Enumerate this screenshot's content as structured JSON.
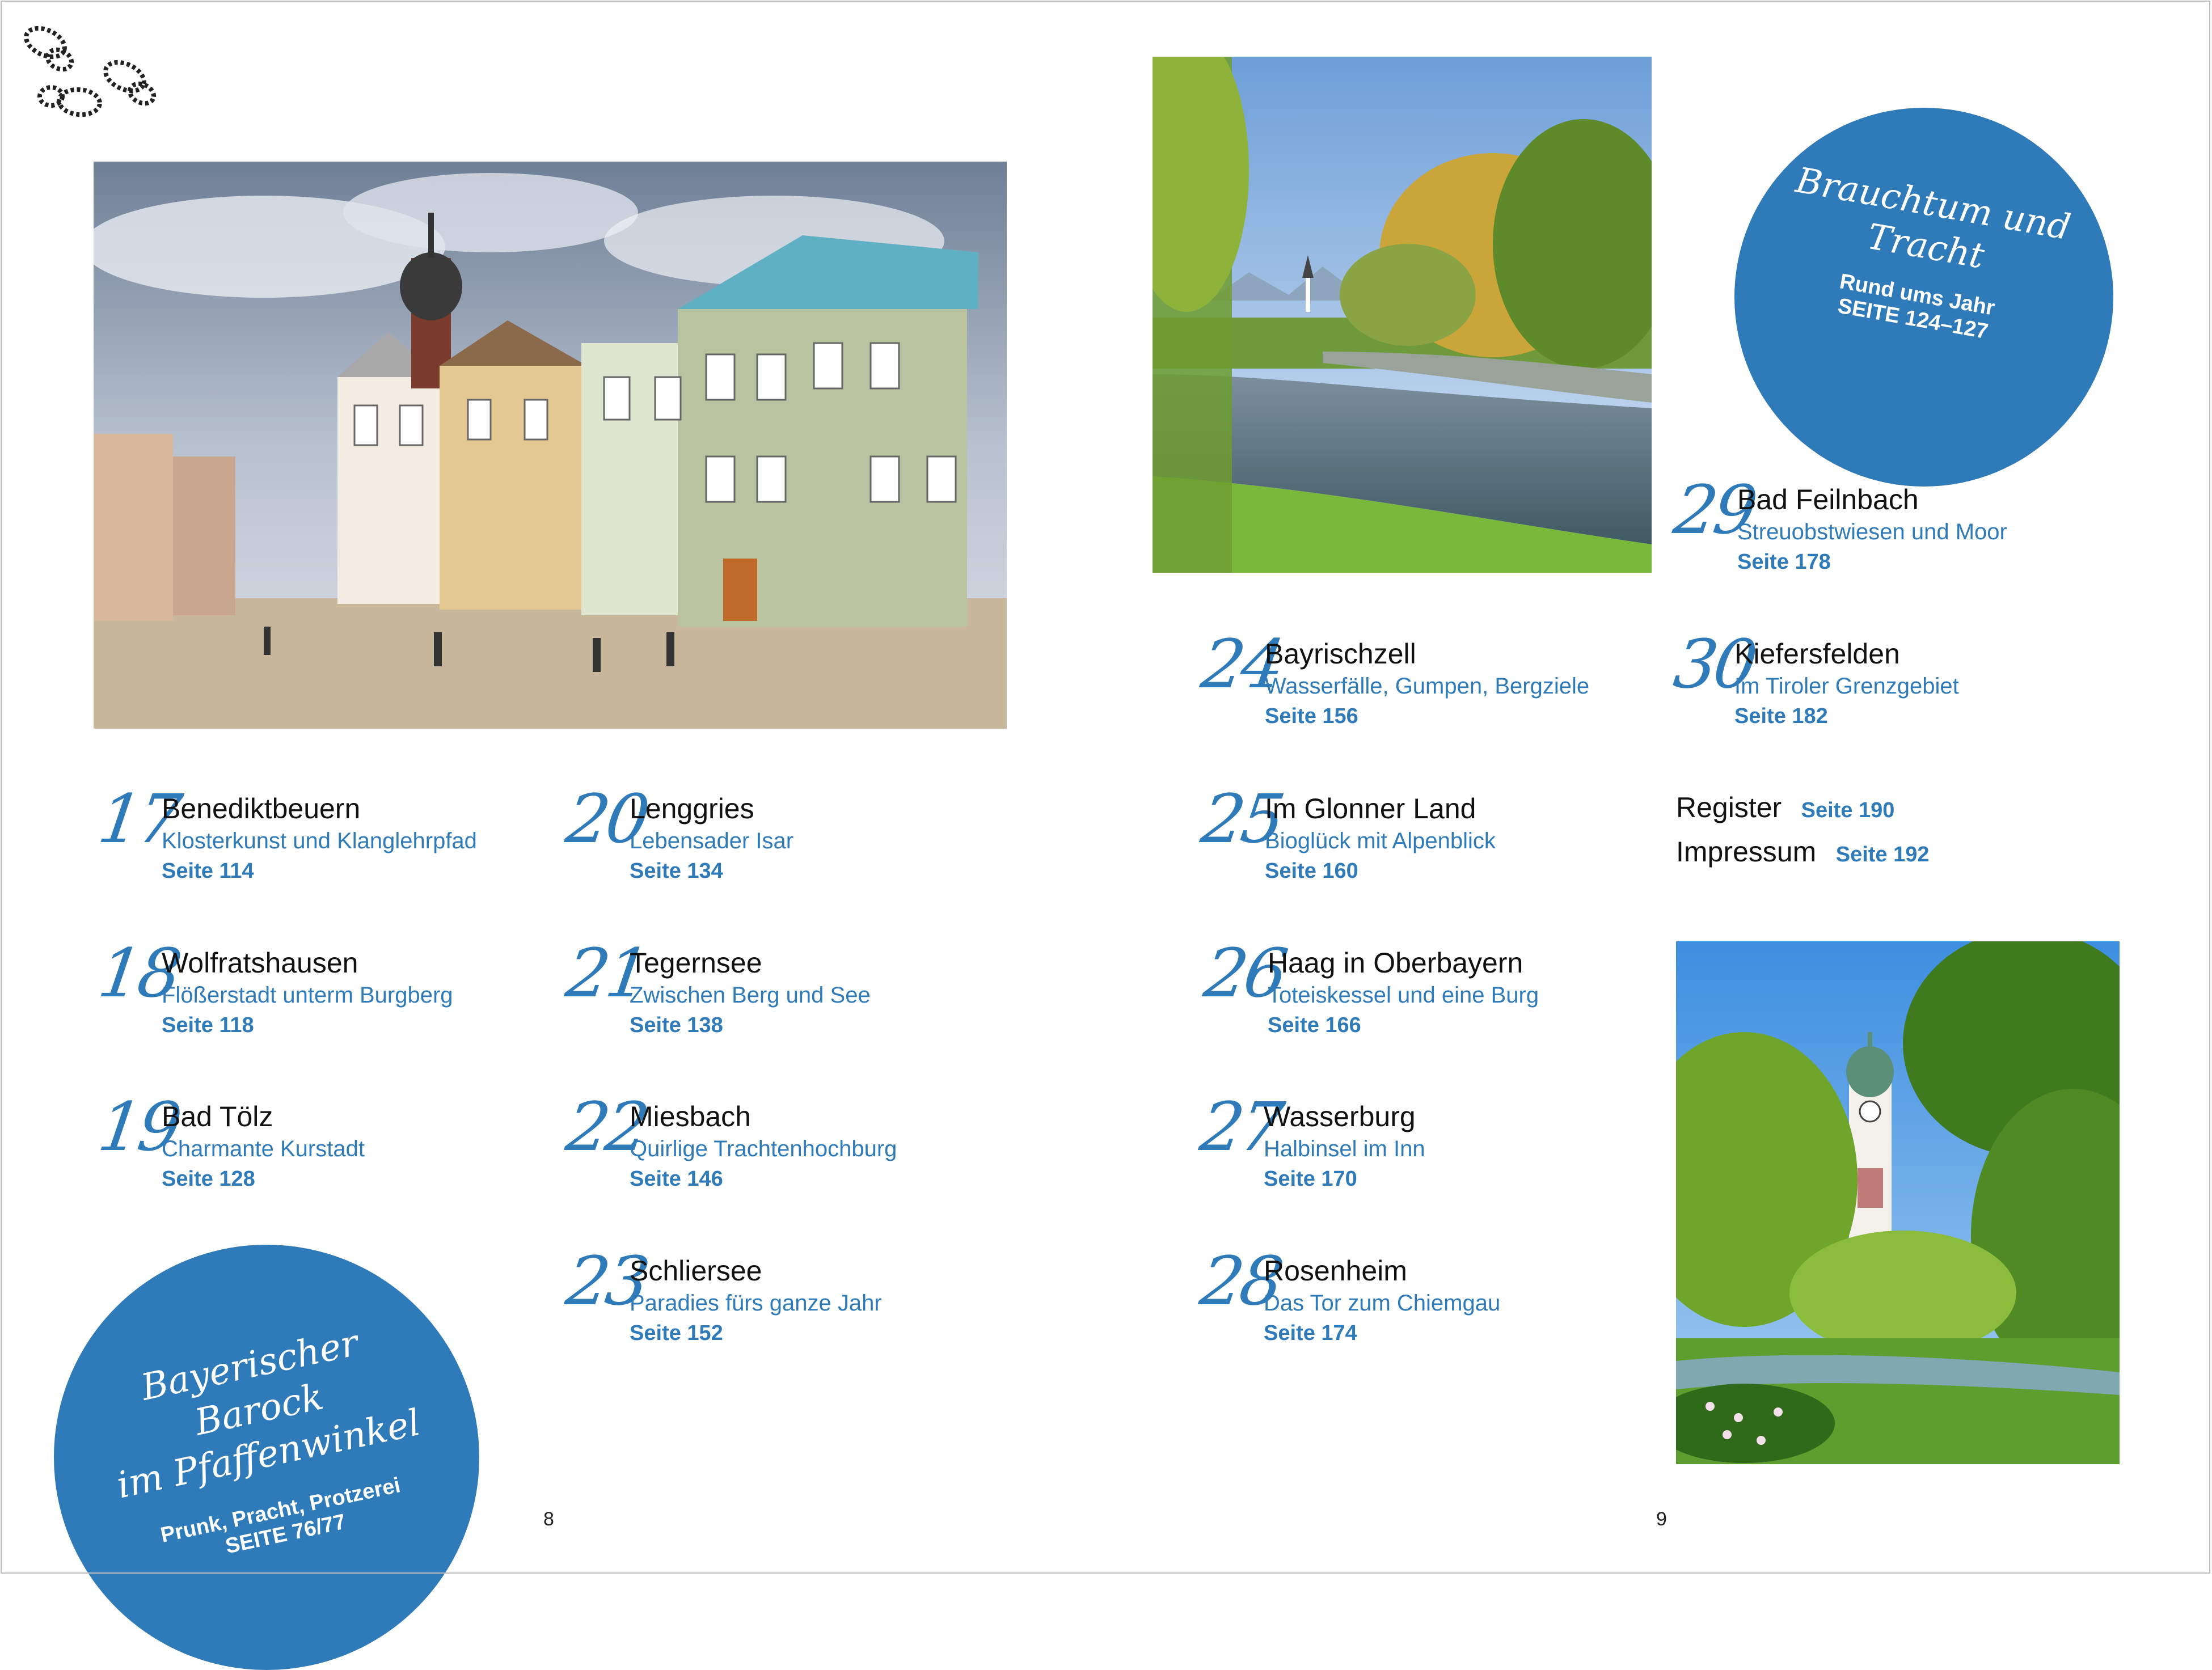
{
  "entries_left": [
    {
      "num": "17",
      "title": "Benediktbeuern",
      "subtitle": "Klosterkunst und Klanglehrpfad",
      "page": "Seite 114"
    },
    {
      "num": "18",
      "title": "Wolfratshausen",
      "subtitle": "Flößerstadt unterm Burgberg",
      "page": "Seite 118"
    },
    {
      "num": "19",
      "title": "Bad Tölz",
      "subtitle": "Charmante Kurstadt",
      "page": "Seite 128"
    },
    {
      "num": "20",
      "title": "Lenggries",
      "subtitle": "Lebensader Isar",
      "page": "Seite 134"
    },
    {
      "num": "21",
      "title": "Tegernsee",
      "subtitle": "Zwischen Berg und See",
      "page": "Seite 138"
    },
    {
      "num": "22",
      "title": "Miesbach",
      "subtitle": "Quirlige Trachtenhochburg",
      "page": "Seite 146"
    },
    {
      "num": "23",
      "title": "Schliersee",
      "subtitle": "Paradies fürs ganze Jahr",
      "page": "Seite 152"
    }
  ],
  "entries_right": [
    {
      "num": "24",
      "title": "Bayrischzell",
      "subtitle": "Wasserfälle, Gumpen, Bergziele",
      "page": "Seite 156"
    },
    {
      "num": "25",
      "title": "Im Glonner Land",
      "subtitle": "Bioglück mit Alpenblick",
      "page": "Seite 160"
    },
    {
      "num": "26",
      "title": "Haag in Oberbayern",
      "subtitle": "Toteiskessel und eine Burg",
      "page": "Seite 166"
    },
    {
      "num": "27",
      "title": "Wasserburg",
      "subtitle": "Halbinsel im Inn",
      "page": "Seite 170"
    },
    {
      "num": "28",
      "title": "Rosenheim",
      "subtitle": "Das Tor zum Chiemgau",
      "page": "Seite 174"
    },
    {
      "num": "29",
      "title": "Bad Feilnbach",
      "subtitle": "Streuobstwiesen und Moor",
      "page": "Seite 178"
    },
    {
      "num": "30",
      "title": "Kiefersfelden",
      "subtitle": "Im Tiroler Grenzgebiet",
      "page": "Seite 182"
    }
  ],
  "register": {
    "label": "Register",
    "page": "Seite 190"
  },
  "impressum": {
    "label": "Impressum",
    "page": "Seite 192"
  },
  "circle_left": {
    "line1": "Bayerischer Barock",
    "line2": "im Pfaffenwinkel",
    "sub": "Prunk, Pracht, Protzerei",
    "page": "SEITE 76/77"
  },
  "circle_right": {
    "line1": "Brauchtum und",
    "line2": "Tracht",
    "sub": "Rund ums Jahr",
    "page": "SEITE 124–127"
  },
  "page_numbers": {
    "left": "8",
    "right": "9"
  },
  "colors": {
    "accent": "#2f7ab8",
    "text": "#111111"
  },
  "icons": {
    "footprints": "footprints-icon"
  }
}
